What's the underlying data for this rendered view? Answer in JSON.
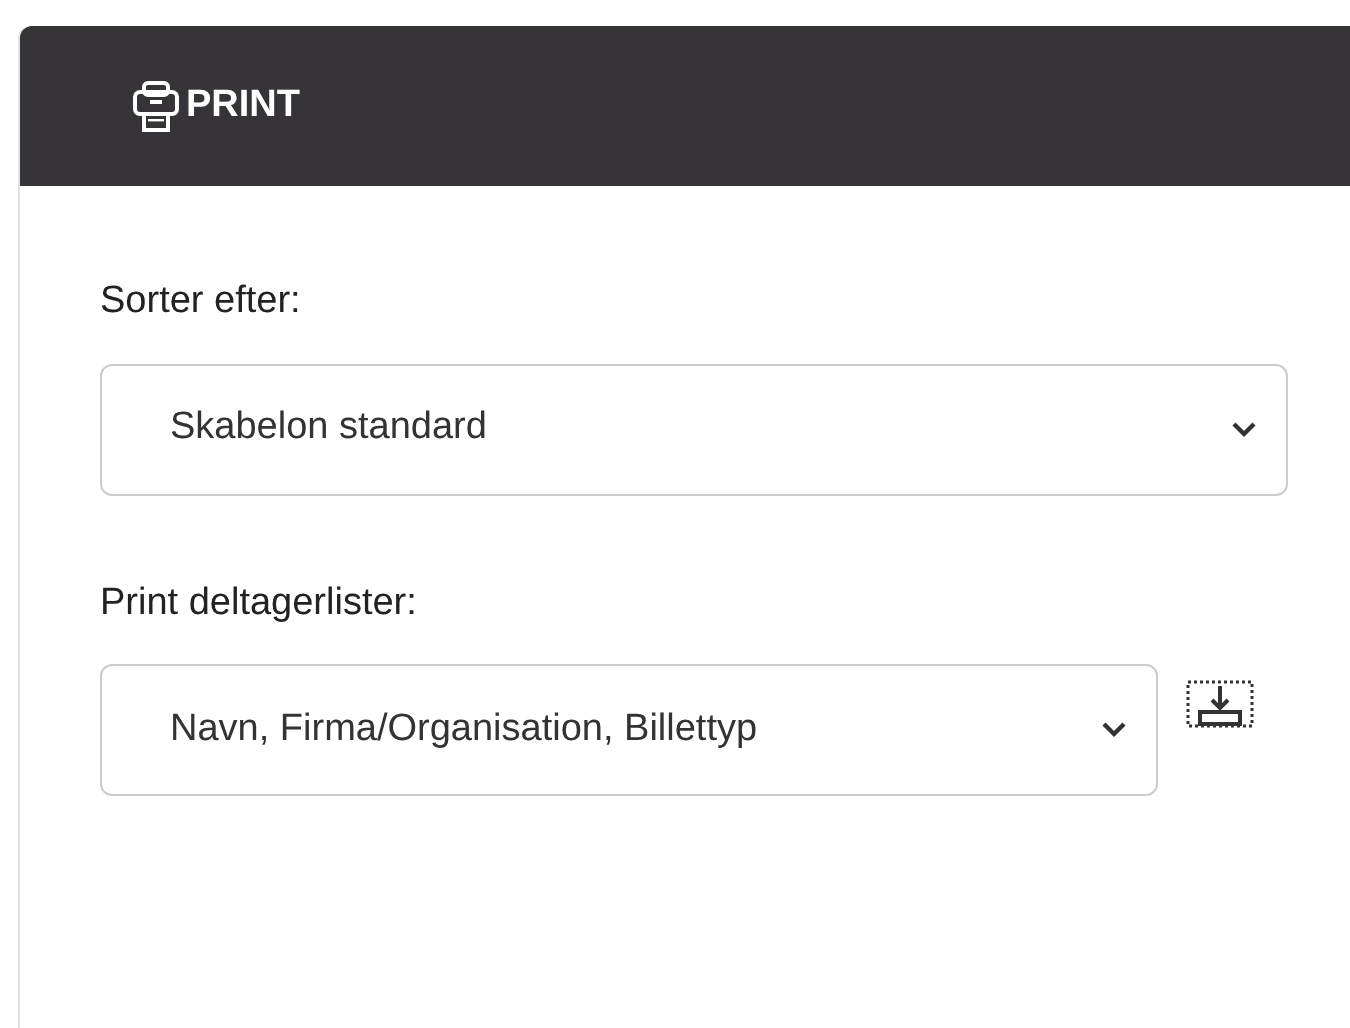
{
  "panel": {
    "title": "PRINT"
  },
  "fields": [
    {
      "label": "Sorter efter:",
      "value": "Skabelon standard",
      "download": false
    },
    {
      "label": "Print deltagerlister:",
      "value": "Navn, Firma/Organisation, Billettyp",
      "download": true
    }
  ]
}
